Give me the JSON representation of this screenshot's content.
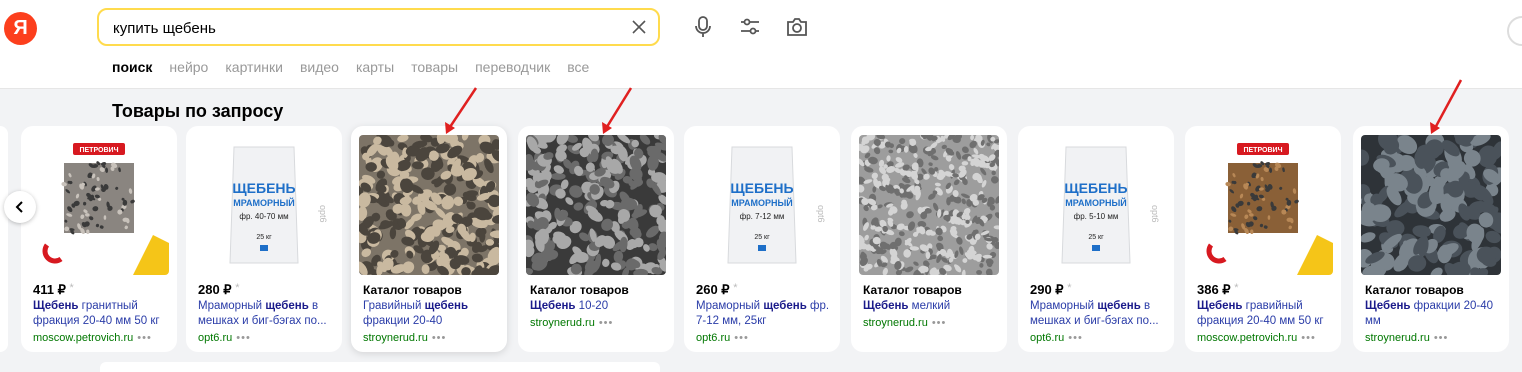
{
  "logo": "Я",
  "search": {
    "value": "купить щебень"
  },
  "tabs": [
    "поиск",
    "нейро",
    "картинки",
    "видео",
    "карты",
    "товары",
    "переводчик",
    "все"
  ],
  "heading": "Товары по запросу",
  "products": [
    {
      "type": "price",
      "price": "411 ₽",
      "star": "*",
      "desc_bold": "Щебень",
      "desc": " гранитный фракция 20-40 мм 50 кг",
      "site": "moscow.petrovich.ru",
      "dots": "•••",
      "image": "petrovich-gravel"
    },
    {
      "type": "price",
      "price": "280 ₽",
      "star": "*",
      "desc_pre": "Мраморный ",
      "desc_bold": "щебень",
      "desc": " в мешках и биг-бэгах по...",
      "site": "opt6.ru",
      "dots": "•••",
      "image": "bag",
      "bag_text": "фр. 40-70 мм"
    },
    {
      "type": "catalog",
      "title": "Каталог товаров",
      "desc_pre": "Гравийный ",
      "desc_bold": "щебень",
      "desc": " фракции 20-40",
      "site": "stroynerud.ru",
      "dots": "•••",
      "image": "gravel-brown"
    },
    {
      "type": "catalog",
      "title": "Каталог товаров",
      "desc_bold": "Щебень",
      "desc": " 10-20",
      "site": "stroynerud.ru",
      "dots": "•••",
      "image": "gravel-grey"
    },
    {
      "type": "price",
      "price": "260 ₽",
      "star": "*",
      "desc_pre": "Мраморный ",
      "desc_bold": "щебень",
      "desc": " фр. 7-12 мм, 25кг",
      "site": "opt6.ru",
      "dots": "•••",
      "image": "bag",
      "bag_text": "фр. 7-12 мм"
    },
    {
      "type": "catalog",
      "title": "Каталог товаров",
      "desc_bold": "Щебень",
      "desc": " мелкий",
      "site": "stroynerud.ru",
      "dots": "•••",
      "image": "gravel-fine"
    },
    {
      "type": "price",
      "price": "290 ₽",
      "star": "*",
      "desc_pre": "Мраморный ",
      "desc_bold": "щебень",
      "desc": " в мешках и биг-бэгах по...",
      "site": "opt6.ru",
      "dots": "•••",
      "image": "bag",
      "bag_text": "фр. 5-10 мм"
    },
    {
      "type": "price",
      "price": "386 ₽",
      "star": "*",
      "desc_bold": "Щебень",
      "desc": " гравийный фракция 20-40 мм 50 кг",
      "site": "moscow.petrovich.ru",
      "dots": "•••",
      "image": "petrovich-brown"
    },
    {
      "type": "catalog",
      "title": "Каталог товаров",
      "desc_bold": "Щебень",
      "desc": " фракции 20-40 мм",
      "site": "stroynerud.ru",
      "dots": "•••",
      "image": "gravel-dark"
    }
  ],
  "bag": {
    "line1": "ЩЕБЕНЬ",
    "line2": "МРАМОРНЫЙ",
    "weight": "25 кг"
  },
  "petrovich": "ПЕТРОВИЧ",
  "colors": {
    "accent": "#ffdb4d",
    "logo": "#fc3f1d",
    "link": "#2a3ca8",
    "site": "#007700",
    "arrow": "#e02020"
  }
}
